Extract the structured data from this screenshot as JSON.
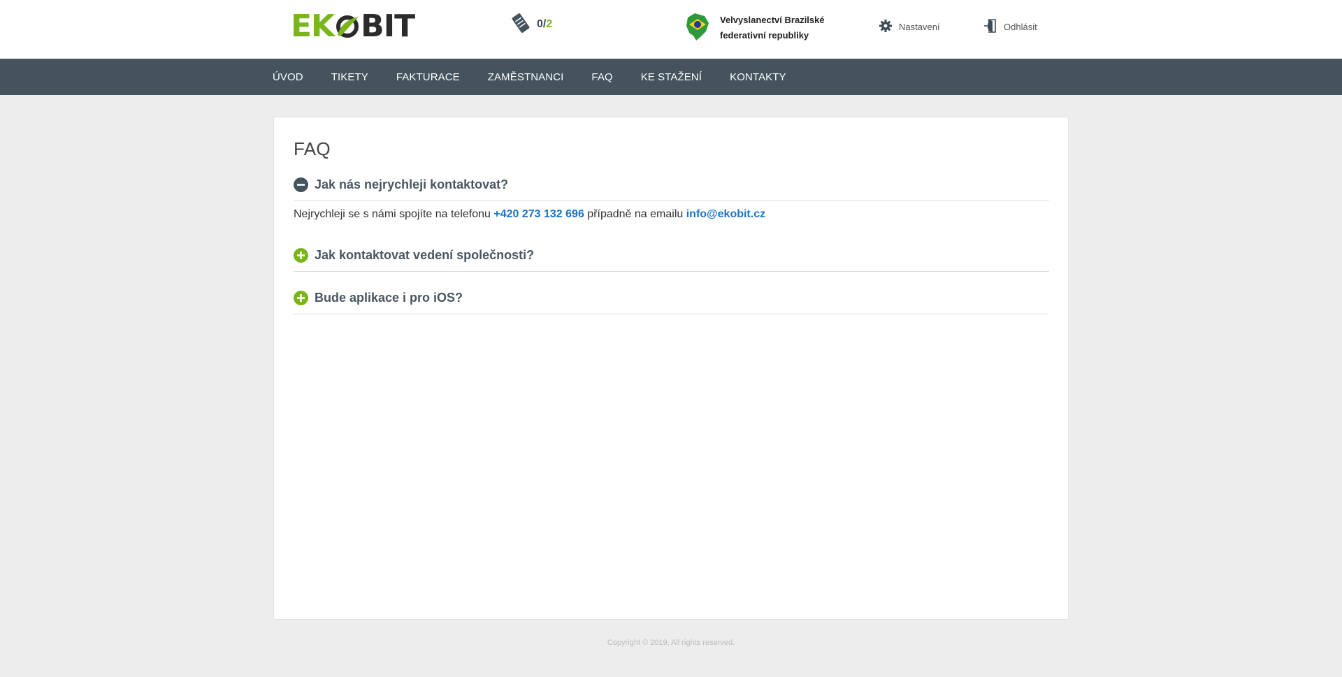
{
  "header": {
    "logo_left": "EK",
    "logo_right": "BIT",
    "tickets": {
      "used": "0/",
      "max": "2"
    },
    "organization": {
      "line1": "Velvyslanectví Brazilské",
      "line2": "federativní republiky"
    },
    "settings_label": "Nastavení",
    "logout_label": "Odhlásit"
  },
  "nav": {
    "items": [
      "Úvod",
      "Tikety",
      "Fakturace",
      "Zaměstnanci",
      "FAQ",
      "Ke stažení",
      "Kontakty"
    ]
  },
  "main": {
    "title": "FAQ",
    "faq": [
      {
        "question": "Jak nás nejrychleji kontaktovat?",
        "expanded": true,
        "answer_prefix": "Nejrychleji se s námi spojíte na telefonu ",
        "phone": "+420 273 132 696",
        "answer_middle": " případně na emailu ",
        "email": "info@ekobit.cz"
      },
      {
        "question": "Jak kontaktovat vedení společnosti?",
        "expanded": false
      },
      {
        "question": "Bude aplikace i pro iOS?",
        "expanded": false
      }
    ]
  },
  "footer": {
    "copyright": "Copyright © 2019, All rights reserved."
  },
  "colors": {
    "accent": "#7ab51d",
    "navbar": "#44535e",
    "link": "#1a73c8",
    "background": "#ededed"
  }
}
